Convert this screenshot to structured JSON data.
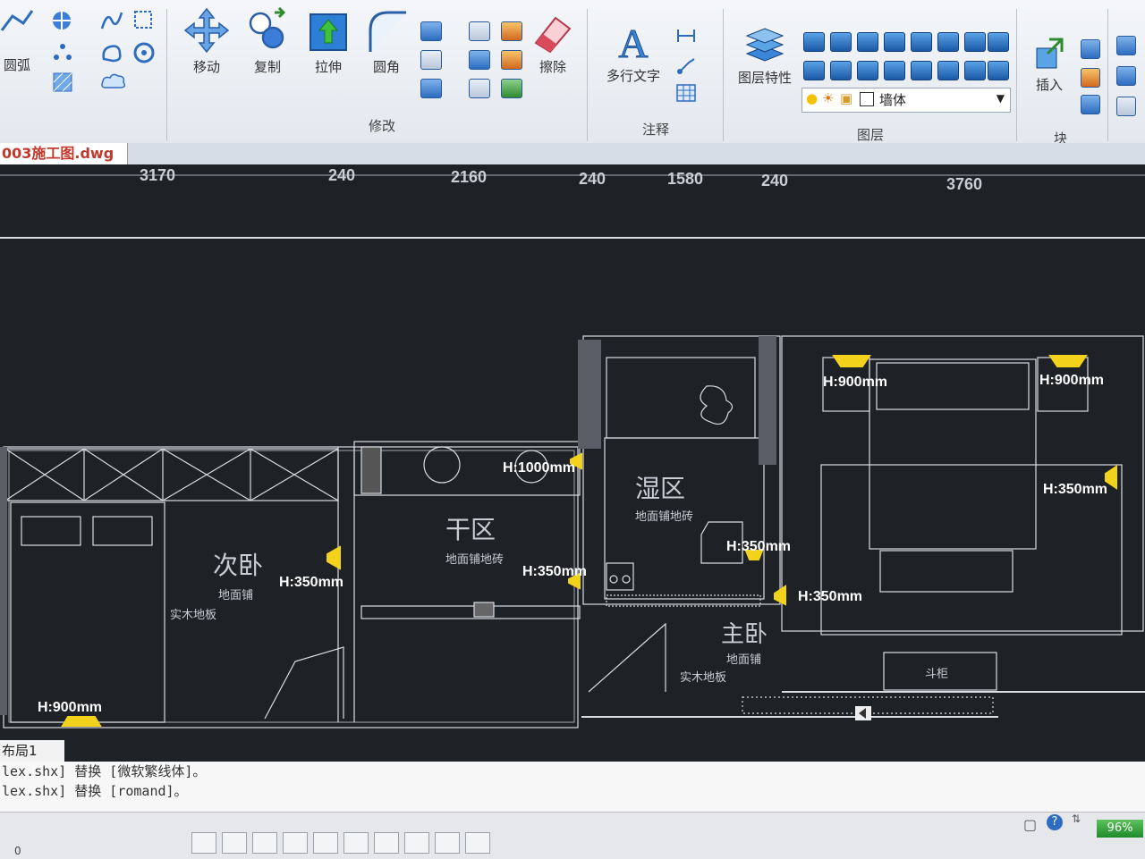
{
  "ribbon": {
    "partial_label": "圆弧",
    "modify": {
      "move": "移动",
      "copy": "复制",
      "stretch": "拉伸",
      "fillet": "圆角",
      "erase": "擦除",
      "panel": "修改"
    },
    "annotation": {
      "mtext": "多行文字",
      "panel": "注释"
    },
    "layers": {
      "properties": "图层特性",
      "current_layer": "墙体",
      "panel": "图层"
    },
    "block": {
      "insert": "插入",
      "panel": "块"
    }
  },
  "document_tab": "003施工图.dwg",
  "dimensions": [
    "3170",
    "240",
    "2160",
    "240",
    "1580",
    "240",
    "3760"
  ],
  "rooms": {
    "second_bedroom": {
      "name": "次卧",
      "note1": "地面铺",
      "note2": "实木地板"
    },
    "dry_zone": {
      "name": "干区",
      "note": "地面铺地砖"
    },
    "wet_zone": {
      "name": "湿区",
      "note": "地面铺地砖"
    },
    "master_bedroom": {
      "name": "主卧",
      "note1": "地面铺",
      "note2": "实木地板"
    },
    "cabinet": "斗柜"
  },
  "heights": {
    "h900_a": "H:900mm",
    "h900_b": "H:900mm",
    "h900_c": "H:900mm",
    "h1000": "H:1000mm",
    "h350_a": "H:350mm",
    "h350_b": "H:350mm",
    "h350_c": "H:350mm",
    "h350_d": "H:350mm",
    "h350_e": "H:350mm"
  },
  "layout_tab": "布局1",
  "command_lines": [
    "lex.shx] 替换 [微软繁线体]。",
    "lex.shx] 替换 [romand]。"
  ],
  "status": {
    "zoom": "96%",
    "coord": "0"
  },
  "colors": {
    "drawing_bg": "#1e2126",
    "line": "#d9dde3",
    "label": "#c9ced6",
    "height_label": "#ffffff",
    "fixture": "#f2d21a"
  }
}
